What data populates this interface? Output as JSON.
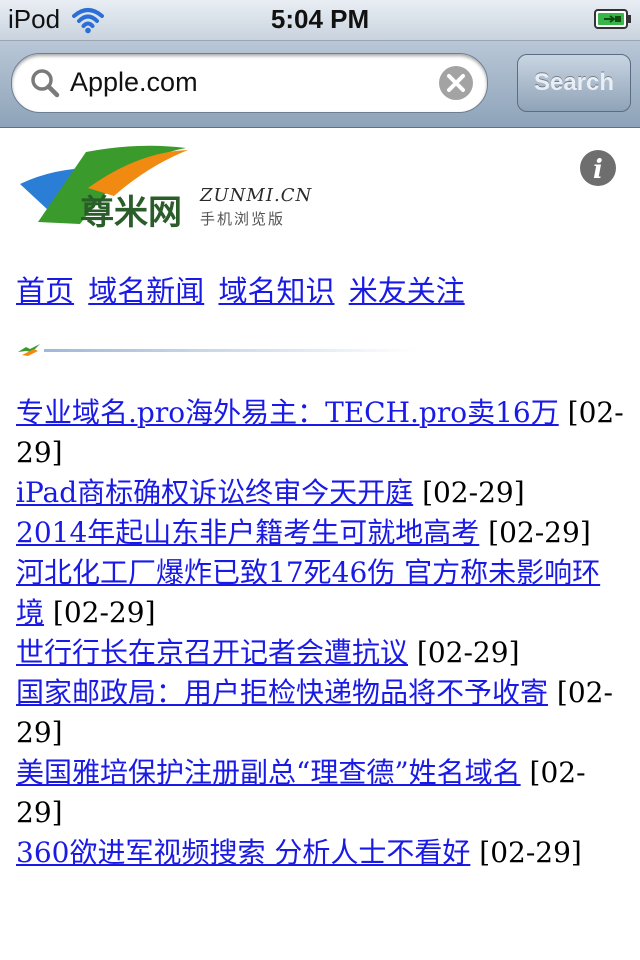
{
  "status_bar": {
    "carrier": "iPod",
    "time": "5:04 PM"
  },
  "search_bar": {
    "url_value": "Apple.com",
    "search_button": "Search"
  },
  "site": {
    "logo_cn": "尊米网",
    "logo_domain": "ZUNMI.CN",
    "logo_tagline": "手机浏览版"
  },
  "nav": [
    "首页",
    "域名新闻",
    "域名知识",
    "米友关注"
  ],
  "news": [
    {
      "title": "专业域名.pro海外易主：TECH.pro卖16万",
      "date": "[02-29]"
    },
    {
      "title": "iPad商标确权诉讼终审今天开庭",
      "date": "[02-29]"
    },
    {
      "title": "2014年起山东非户籍考生可就地高考",
      "date": "[02-29]"
    },
    {
      "title": "河北化工厂爆炸已致17死46伤 官方称未影响环境",
      "date": "[02-29]"
    },
    {
      "title": "世行行长在京召开记者会遭抗议",
      "date": "[02-29]"
    },
    {
      "title": "国家邮政局：用户拒检快递物品将不予收寄",
      "date": "[02-29]"
    },
    {
      "title": "美国雅培保护注册副总“理查德”姓名域名",
      "date": "[02-29]"
    },
    {
      "title": "360欲进军视频搜索 分析人士不看好",
      "date": "[02-29]"
    }
  ],
  "colors": {
    "link": "#1a1ae6",
    "logo_green": "#3a9a2c",
    "logo_orange": "#f08a10",
    "logo_blue": "#2b7ed6"
  },
  "icons": {
    "wifi": "wifi-icon",
    "battery": "battery-charging-icon",
    "search": "search-icon",
    "clear": "clear-icon",
    "info": "info-icon"
  }
}
